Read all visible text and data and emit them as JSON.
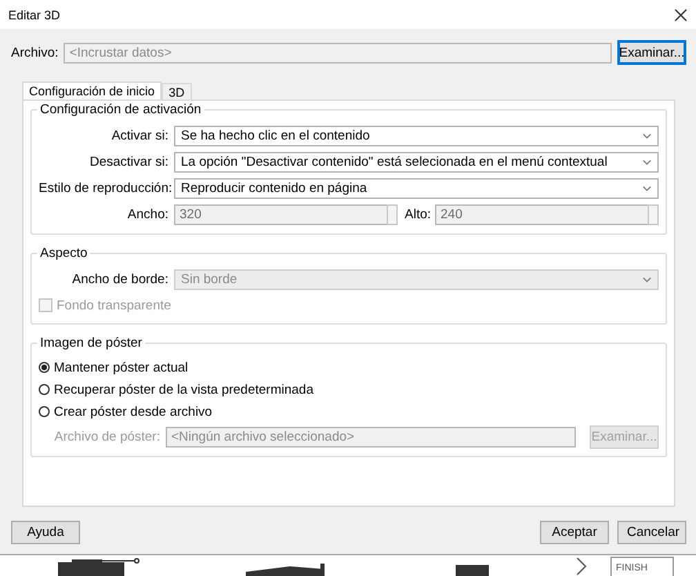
{
  "window": {
    "title": "Editar 3D"
  },
  "file": {
    "label": "Archivo:",
    "placeholder": "<Incrustar datos>",
    "button": "Examinar..."
  },
  "tabs": [
    {
      "label": "Configuración de inicio",
      "selected": true
    },
    {
      "label": "3D",
      "selected": false
    }
  ],
  "activation": {
    "title": "Configuración de activación",
    "rows": [
      {
        "label": "Activar si:",
        "value": "Se ha hecho clic en el contenido"
      },
      {
        "label": "Desactivar si:",
        "value": "La opción \"Desactivar contenido\" está selecionada en el menú contextual"
      },
      {
        "label": "Estilo de reproducción:",
        "value": "Reproducir contenido en página"
      }
    ],
    "size": [
      {
        "label": "Ancho:",
        "value": "320",
        "disabled": true
      },
      {
        "label": "Alto:",
        "value": "240",
        "disabled": true
      }
    ]
  },
  "appearance": {
    "title": "Aspecto",
    "border": {
      "label": "Ancho de borde:",
      "value": "Sin borde",
      "disabled": true
    },
    "transparent": {
      "label": "Fondo transparente",
      "checked": false,
      "disabled": true
    }
  },
  "poster": {
    "title": "Imagen de póster",
    "options": [
      {
        "label": "Mantener póster actual",
        "selected": true
      },
      {
        "label": "Recuperar póster de la vista predeterminada",
        "selected": false
      },
      {
        "label": "Crear póster desde archivo",
        "selected": false
      }
    ],
    "file": {
      "label": "Archivo de póster:",
      "placeholder": "<Ningún archivo seleccionado>",
      "button": "Examinar...",
      "disabled": true
    }
  },
  "buttons": {
    "help": "Ayuda",
    "ok": "Aceptar",
    "cancel": "Cancelar"
  },
  "background": {
    "label": "FINISH"
  }
}
